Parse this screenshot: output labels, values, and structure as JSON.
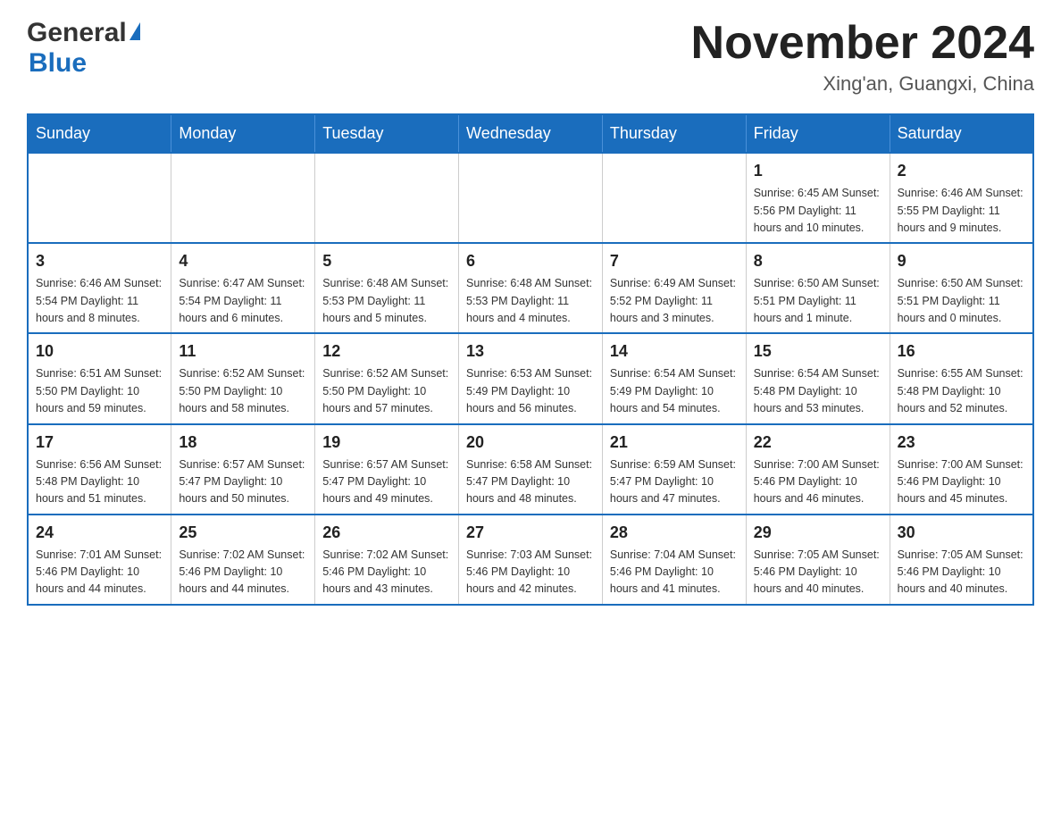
{
  "header": {
    "logo_general": "General",
    "logo_blue": "Blue",
    "month_title": "November 2024",
    "location": "Xing'an, Guangxi, China"
  },
  "weekdays": [
    "Sunday",
    "Monday",
    "Tuesday",
    "Wednesday",
    "Thursday",
    "Friday",
    "Saturday"
  ],
  "weeks": [
    [
      {
        "day": "",
        "info": ""
      },
      {
        "day": "",
        "info": ""
      },
      {
        "day": "",
        "info": ""
      },
      {
        "day": "",
        "info": ""
      },
      {
        "day": "",
        "info": ""
      },
      {
        "day": "1",
        "info": "Sunrise: 6:45 AM\nSunset: 5:56 PM\nDaylight: 11 hours\nand 10 minutes."
      },
      {
        "day": "2",
        "info": "Sunrise: 6:46 AM\nSunset: 5:55 PM\nDaylight: 11 hours\nand 9 minutes."
      }
    ],
    [
      {
        "day": "3",
        "info": "Sunrise: 6:46 AM\nSunset: 5:54 PM\nDaylight: 11 hours\nand 8 minutes."
      },
      {
        "day": "4",
        "info": "Sunrise: 6:47 AM\nSunset: 5:54 PM\nDaylight: 11 hours\nand 6 minutes."
      },
      {
        "day": "5",
        "info": "Sunrise: 6:48 AM\nSunset: 5:53 PM\nDaylight: 11 hours\nand 5 minutes."
      },
      {
        "day": "6",
        "info": "Sunrise: 6:48 AM\nSunset: 5:53 PM\nDaylight: 11 hours\nand 4 minutes."
      },
      {
        "day": "7",
        "info": "Sunrise: 6:49 AM\nSunset: 5:52 PM\nDaylight: 11 hours\nand 3 minutes."
      },
      {
        "day": "8",
        "info": "Sunrise: 6:50 AM\nSunset: 5:51 PM\nDaylight: 11 hours\nand 1 minute."
      },
      {
        "day": "9",
        "info": "Sunrise: 6:50 AM\nSunset: 5:51 PM\nDaylight: 11 hours\nand 0 minutes."
      }
    ],
    [
      {
        "day": "10",
        "info": "Sunrise: 6:51 AM\nSunset: 5:50 PM\nDaylight: 10 hours\nand 59 minutes."
      },
      {
        "day": "11",
        "info": "Sunrise: 6:52 AM\nSunset: 5:50 PM\nDaylight: 10 hours\nand 58 minutes."
      },
      {
        "day": "12",
        "info": "Sunrise: 6:52 AM\nSunset: 5:50 PM\nDaylight: 10 hours\nand 57 minutes."
      },
      {
        "day": "13",
        "info": "Sunrise: 6:53 AM\nSunset: 5:49 PM\nDaylight: 10 hours\nand 56 minutes."
      },
      {
        "day": "14",
        "info": "Sunrise: 6:54 AM\nSunset: 5:49 PM\nDaylight: 10 hours\nand 54 minutes."
      },
      {
        "day": "15",
        "info": "Sunrise: 6:54 AM\nSunset: 5:48 PM\nDaylight: 10 hours\nand 53 minutes."
      },
      {
        "day": "16",
        "info": "Sunrise: 6:55 AM\nSunset: 5:48 PM\nDaylight: 10 hours\nand 52 minutes."
      }
    ],
    [
      {
        "day": "17",
        "info": "Sunrise: 6:56 AM\nSunset: 5:48 PM\nDaylight: 10 hours\nand 51 minutes."
      },
      {
        "day": "18",
        "info": "Sunrise: 6:57 AM\nSunset: 5:47 PM\nDaylight: 10 hours\nand 50 minutes."
      },
      {
        "day": "19",
        "info": "Sunrise: 6:57 AM\nSunset: 5:47 PM\nDaylight: 10 hours\nand 49 minutes."
      },
      {
        "day": "20",
        "info": "Sunrise: 6:58 AM\nSunset: 5:47 PM\nDaylight: 10 hours\nand 48 minutes."
      },
      {
        "day": "21",
        "info": "Sunrise: 6:59 AM\nSunset: 5:47 PM\nDaylight: 10 hours\nand 47 minutes."
      },
      {
        "day": "22",
        "info": "Sunrise: 7:00 AM\nSunset: 5:46 PM\nDaylight: 10 hours\nand 46 minutes."
      },
      {
        "day": "23",
        "info": "Sunrise: 7:00 AM\nSunset: 5:46 PM\nDaylight: 10 hours\nand 45 minutes."
      }
    ],
    [
      {
        "day": "24",
        "info": "Sunrise: 7:01 AM\nSunset: 5:46 PM\nDaylight: 10 hours\nand 44 minutes."
      },
      {
        "day": "25",
        "info": "Sunrise: 7:02 AM\nSunset: 5:46 PM\nDaylight: 10 hours\nand 44 minutes."
      },
      {
        "day": "26",
        "info": "Sunrise: 7:02 AM\nSunset: 5:46 PM\nDaylight: 10 hours\nand 43 minutes."
      },
      {
        "day": "27",
        "info": "Sunrise: 7:03 AM\nSunset: 5:46 PM\nDaylight: 10 hours\nand 42 minutes."
      },
      {
        "day": "28",
        "info": "Sunrise: 7:04 AM\nSunset: 5:46 PM\nDaylight: 10 hours\nand 41 minutes."
      },
      {
        "day": "29",
        "info": "Sunrise: 7:05 AM\nSunset: 5:46 PM\nDaylight: 10 hours\nand 40 minutes."
      },
      {
        "day": "30",
        "info": "Sunrise: 7:05 AM\nSunset: 5:46 PM\nDaylight: 10 hours\nand 40 minutes."
      }
    ]
  ]
}
